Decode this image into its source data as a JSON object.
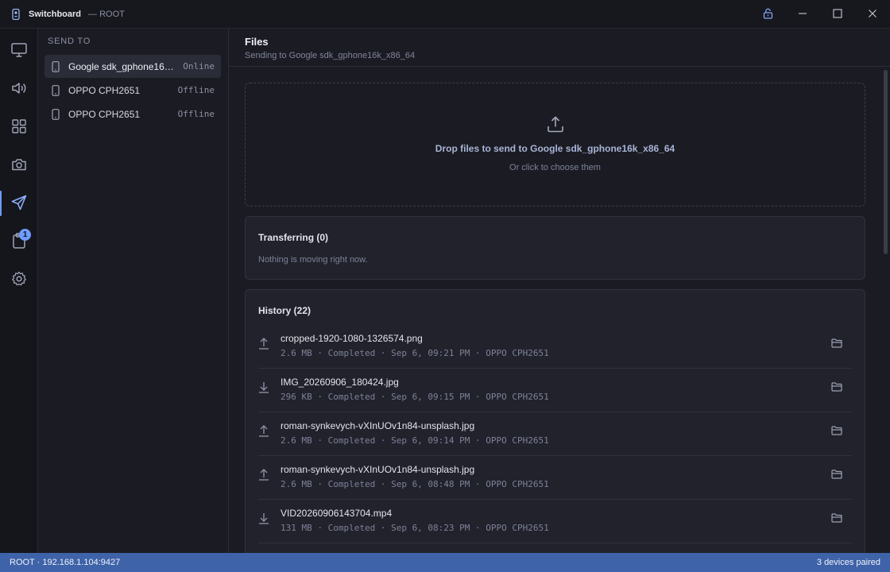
{
  "window": {
    "title": "Switchboard",
    "subtitle": "— ROOT",
    "icons": {
      "logo": "remote-icon",
      "lock": "lock-icon",
      "minimize": "minimize-icon",
      "maximize": "maximize-icon",
      "close": "close-icon"
    },
    "accent": "#6f9bff"
  },
  "rail": {
    "items": [
      {
        "icon": "monitor-icon"
      },
      {
        "icon": "volume-icon"
      },
      {
        "icon": "grid-icon"
      },
      {
        "icon": "camera-icon"
      },
      {
        "icon": "send-icon",
        "active": true
      },
      {
        "icon": "clipboard-icon",
        "badge": "1"
      },
      {
        "icon": "settings-icon"
      }
    ]
  },
  "devices": {
    "heading": "SEND TO",
    "items": [
      {
        "name": "Google sdk_gphone16k...",
        "status": "Online",
        "selected": true
      },
      {
        "name": "OPPO CPH2651",
        "status": "Offline"
      },
      {
        "name": "OPPO CPH2651",
        "status": "Offline"
      }
    ]
  },
  "main": {
    "title": "Files",
    "subtitle": "Sending to Google sdk_gphone16k_x86_64",
    "dropzone": {
      "icon": "upload-icon",
      "title": "Drop files to send to Google sdk_gphone16k_x86_64",
      "subtitle": "Or click to choose them"
    },
    "transferring": {
      "title": "Transferring (0)",
      "empty": "Nothing is moving right now."
    },
    "history": {
      "title": "History (22)",
      "items": [
        {
          "direction": "upload",
          "name": "cropped-1920-1080-1326574.png",
          "meta": "2.6 MB · Completed · Sep 6, 09:21 PM · OPPO CPH2651"
        },
        {
          "direction": "download",
          "name": "IMG_20260906_180424.jpg",
          "meta": "296 KB · Completed · Sep 6, 09:15 PM · OPPO CPH2651"
        },
        {
          "direction": "upload",
          "name": "roman-synkevych-vXInUOv1n84-unsplash.jpg",
          "meta": "2.6 MB · Completed · Sep 6, 09:14 PM · OPPO CPH2651"
        },
        {
          "direction": "upload",
          "name": "roman-synkevych-vXInUOv1n84-unsplash.jpg",
          "meta": "2.6 MB · Completed · Sep 6, 08:48 PM · OPPO CPH2651"
        },
        {
          "direction": "download",
          "name": "VID20260906143704.mp4",
          "meta": "131 MB · Completed · Sep 6, 08:23 PM · OPPO CPH2651"
        }
      ]
    }
  },
  "statusbar": {
    "left": "ROOT · 192.168.1.104:9427",
    "right": "3 devices paired",
    "color": "#3f63a8"
  }
}
